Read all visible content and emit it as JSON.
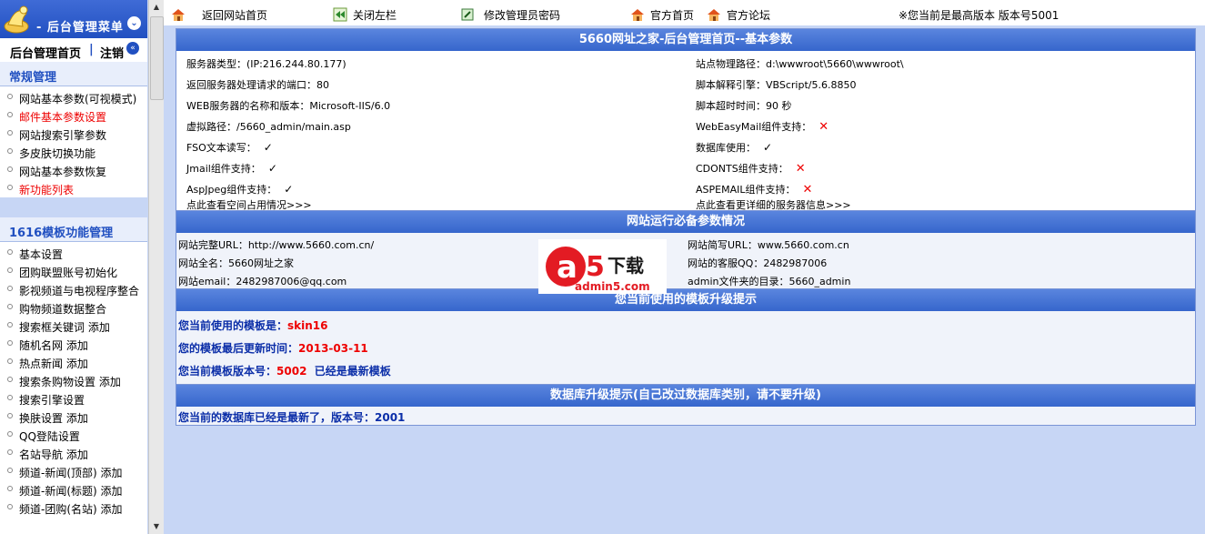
{
  "sidebar": {
    "title": "- 后台管理菜单",
    "tab_home": "后台管理首页",
    "tab_sep": "|",
    "tab_logout": "注销",
    "section1_title": "常规管理",
    "section1_items": [
      {
        "label": "网站基本参数(可视模式)",
        "red": false
      },
      {
        "label": "邮件基本参数设置",
        "red": true
      },
      {
        "label": "网站搜索引擎参数",
        "red": false
      },
      {
        "label": "多皮肤切换功能",
        "red": false
      },
      {
        "label": "网站基本参数恢复",
        "red": false
      },
      {
        "label": "新功能列表",
        "red": true
      }
    ],
    "section2_title": "1616模板功能管理",
    "section2_items": [
      "基本设置",
      "团购联盟账号初始化",
      "影视频道与电视程序整合",
      "购物频道数据整合",
      "搜索框关键词 添加",
      "随机名网 添加",
      "热点新闻 添加",
      "搜索条购物设置 添加",
      "搜索引擎设置",
      "换肤设置 添加",
      "QQ登陆设置",
      "名站导航 添加",
      "频道-新闻(顶部) 添加",
      "频道-新闻(标题) 添加",
      "频道-团购(名站) 添加"
    ]
  },
  "topbar": {
    "back_home": "返回网站首页",
    "close_left": "关闭左栏",
    "change_pwd": "修改管理员密码",
    "official_home": "官方首页",
    "official_forum": "官方论坛",
    "version_text": "※您当前是最高版本  版本号5001"
  },
  "panel1": {
    "title": "5660网址之家-后台管理首页--基本参数",
    "left": [
      "服务器类型：(IP:216.244.80.177)",
      "返回服务器处理请求的端口：80",
      "WEB服务器的名称和版本：Microsoft-IIS/6.0",
      "虚拟路径：/5660_admin/main.asp",
      "FSO文本读写：",
      "Jmail组件支持：",
      "AspJpeg组件支持："
    ],
    "left_status": [
      "",
      "",
      "",
      "",
      "check",
      "check",
      "check"
    ],
    "right": [
      "站点物理路径：d:\\wwwroot\\5660\\wwwroot\\",
      "脚本解释引擎：VBScript/5.6.8850",
      "脚本超时时间：90 秒",
      "WebEasyMail组件支持：",
      "数据库使用：",
      "CDONTS组件支持：",
      "ASPEMAIL组件支持："
    ],
    "right_status": [
      "",
      "",
      "",
      "cross",
      "check",
      "cross",
      "cross"
    ],
    "link_space": "点此查看空间占用情况>>>",
    "link_server": "点此查看更详细的服务器信息>>>"
  },
  "panel2": {
    "title": "网站运行必备参数情况",
    "left": [
      "网站完整URL：http://www.5660.com.cn/",
      "网站全名：5660网址之家",
      "网站email：2482987006@qq.com"
    ],
    "right": [
      "网站简写URL：www.5660.com.cn",
      "网站的客服QQ：2482987006",
      "admin文件夹的目录：5660_admin"
    ]
  },
  "watermark": {
    "big": "a",
    "five": "5",
    "xiazai": "下载",
    "domain": "admin5.com"
  },
  "panel3": {
    "title": "您当前使用的模板升级提示",
    "template_label": "您当前使用的模板是：",
    "template_value": "skin16",
    "updated_label": "您的模板最后更新时间：",
    "updated_value": "2013-03-11",
    "version_label": "您当前模板版本号：",
    "version_value": "5002",
    "latest_note": "已经是最新模板"
  },
  "panel4": {
    "title": "数据库升级提示(自己改过数据库类别，请不要升级)",
    "note": "您当前的数据库已经是最新了，版本号：2001"
  },
  "symbols": {
    "check": "✓",
    "cross": "✕"
  },
  "colors": {
    "header_blue": "#2150c1",
    "link_red": "#ee0000",
    "label_blue": "#0b2ea8"
  }
}
